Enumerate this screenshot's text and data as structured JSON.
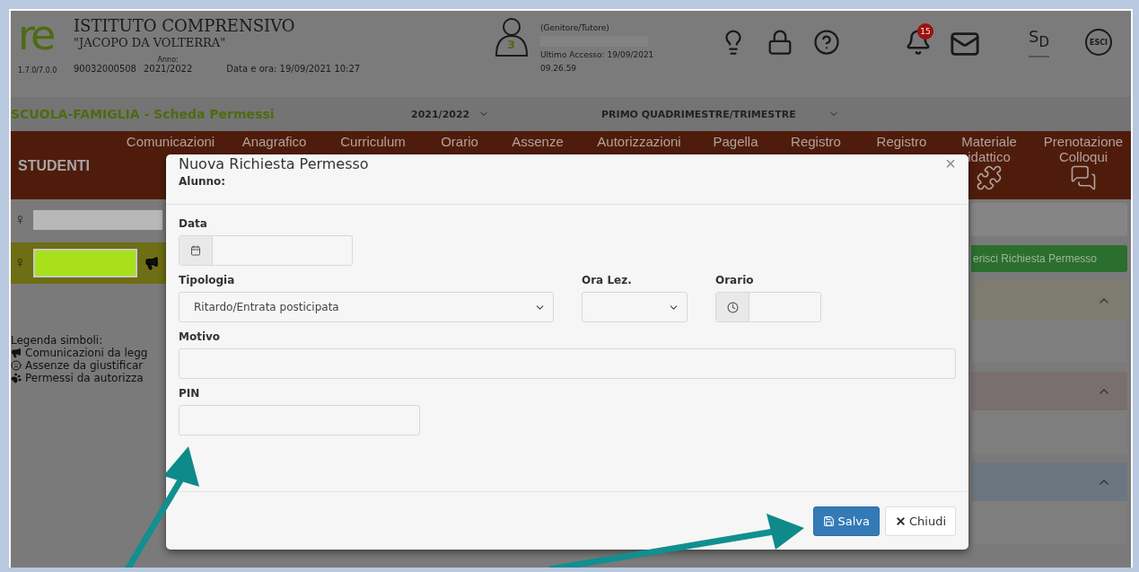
{
  "header": {
    "logo_text": "re",
    "school_line1": "ISTITUTO COMPRENSIVO",
    "school_line2": "\"JACOPO DA VOLTERRA\"",
    "version": "1.7.0/7.0.0",
    "code": "90032000508",
    "year_label": "Anno:",
    "year": "2021/2022",
    "datetime": "Data e ora: 19/09/2021 10:27",
    "avatar_count": "3",
    "user_role": "(Genitore/Tutore)",
    "last_access": "Ultimo Accesso: 19/09/2021",
    "last_access_time": "09.26.59",
    "notification_count": "15",
    "brand_letters": [
      "S",
      "D"
    ],
    "logout_label": "ESCI"
  },
  "subheader": {
    "title": "SCUOLA-FAMIGLIA - Scheda Permessi",
    "year_select": "2021/2022",
    "period_select": "PRIMO QUADRIMESTRE/TRIMESTRE"
  },
  "nav": {
    "section": "STUDENTI",
    "items": [
      {
        "lines": [
          "Comunicazioni"
        ]
      },
      {
        "lines": [
          "Anagrafico"
        ]
      },
      {
        "lines": [
          "Curriculum"
        ]
      },
      {
        "lines": [
          "Orario"
        ]
      },
      {
        "lines": [
          "Assenze"
        ]
      },
      {
        "lines": [
          "Autorizzazioni"
        ]
      },
      {
        "lines": [
          "Pagella"
        ]
      },
      {
        "lines": [
          "Registro"
        ]
      },
      {
        "lines": [
          "Registro"
        ]
      },
      {
        "lines": [
          "Materiale",
          "idattico"
        ]
      },
      {
        "lines": [
          "Prenotazione",
          "Colloqui"
        ]
      }
    ]
  },
  "students": [
    {
      "gender_glyph": "♀",
      "selected": false
    },
    {
      "gender_glyph": "♀",
      "selected": true
    }
  ],
  "legend": {
    "title": "Legenda simboli:",
    "items": [
      {
        "text": "Comunicazioni da legg"
      },
      {
        "text": "Assenze da giustificar"
      },
      {
        "text": "Permessi da autorizza"
      }
    ]
  },
  "right": {
    "insert_button": "erisci Richiesta Permesso",
    "panels": [
      {
        "color": "#7e7c71"
      },
      {
        "color": "#796f6f"
      },
      {
        "color": "#6c7680"
      }
    ]
  },
  "modal": {
    "title": "Nuova Richiesta Permesso",
    "student_label": "Alunno:",
    "close_glyph": "×",
    "rows": [
      {
        "fields": [
          {
            "kind": "date",
            "label": "Data"
          }
        ]
      },
      {
        "fields": [
          {
            "kind": "select",
            "label": "Tipologia",
            "value": "Ritardo/Entrata posticipata"
          },
          {
            "kind": "select",
            "label": "Ora Lez."
          },
          {
            "kind": "time",
            "label": "Orario"
          }
        ]
      },
      {
        "fields": [
          {
            "kind": "text",
            "label": "Motivo"
          }
        ]
      },
      {
        "fields": [
          {
            "kind": "text",
            "label": "PIN"
          }
        ]
      }
    ],
    "buttons": [
      {
        "kind": "primary",
        "label": "Salva"
      },
      {
        "kind": "default",
        "label": "Chiudi"
      }
    ]
  }
}
